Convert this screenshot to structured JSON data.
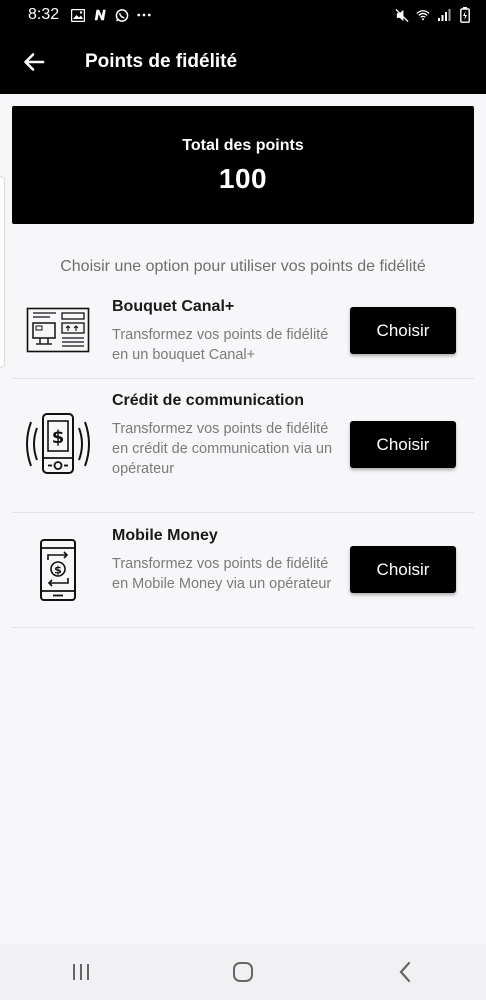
{
  "status_bar": {
    "time": "8:32",
    "left_icons": [
      "image-icon",
      "n-app-icon",
      "whatsapp-icon",
      "more-dots-icon"
    ],
    "right_icons": [
      "mute-icon",
      "wifi-icon",
      "signal-icon",
      "battery-icon"
    ]
  },
  "app_bar": {
    "back_icon": "arrow-left-icon",
    "title": "Points de fidélité"
  },
  "total_card": {
    "label": "Total des points",
    "value": "100"
  },
  "subtitle": "Choisir une option pour utiliser vos points de fidélité",
  "options": [
    {
      "icon": "tv-box-icon",
      "title": "Bouquet Canal+",
      "description": "Transformez vos points de fidélité en un bouquet Canal+",
      "button_label": "Choisir"
    },
    {
      "icon": "phone-money-icon",
      "title": "Crédit de communication",
      "description": "Transformez vos points de fidélité en crédit de communication via un opérateur",
      "button_label": "Choisir"
    },
    {
      "icon": "mobile-money-icon",
      "title": "Mobile Money",
      "description": "Transformez vos points de fidélité en Mobile Money via un opérateur",
      "button_label": "Choisir"
    }
  ],
  "nav_bar": {
    "icons": [
      "recents-icon",
      "home-icon",
      "back-nav-icon"
    ]
  }
}
